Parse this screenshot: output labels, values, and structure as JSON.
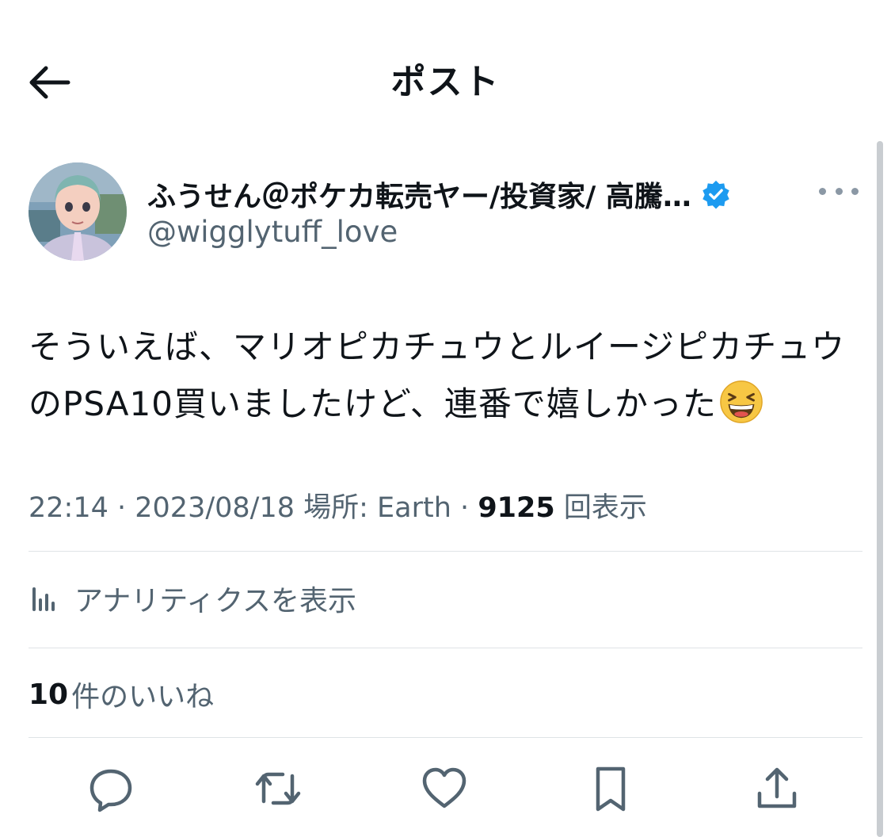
{
  "header": {
    "title": "ポスト",
    "back_icon": "arrow-left-icon"
  },
  "author": {
    "display_name": "ふうせん＠ポケカ転売ヤー/投資家/ 高騰…",
    "handle": "@wigglytuff_love",
    "verified": true,
    "verified_color": "#1d9bf0"
  },
  "tweet": {
    "text": "そういえば、マリオピカチュウとルイージピカチュウのPSA10買いましたけど、連番で嬉しかった",
    "emoji": "grinning-squinting-face"
  },
  "meta": {
    "time": "22:14",
    "separator": " · ",
    "date": "2023/08/18",
    "location": "場所: Earth",
    "views_count": "9125",
    "views_label": "回表示"
  },
  "analytics": {
    "label": "アナリティクスを表示"
  },
  "likes": {
    "count": "10",
    "label": "件のいいね"
  },
  "actions": [
    {
      "icon": "reply-icon"
    },
    {
      "icon": "retweet-icon"
    },
    {
      "icon": "like-icon"
    },
    {
      "icon": "bookmark-icon"
    },
    {
      "icon": "share-icon"
    }
  ],
  "colors": {
    "text_primary": "#0f1419",
    "text_secondary": "#536471",
    "divider": "#dfe3e6"
  }
}
